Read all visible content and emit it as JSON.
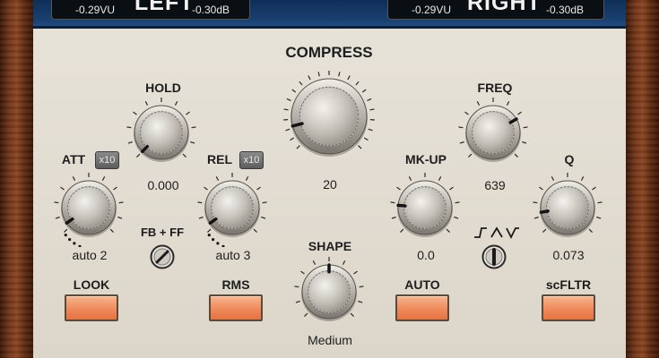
{
  "meters": {
    "left": {
      "vu": "-0.29VU",
      "db": "-0.30dB",
      "label": "LEFT"
    },
    "right": {
      "vu": "-0.29VU",
      "db": "-0.30dB",
      "label": "RIGHT"
    }
  },
  "knobs": {
    "compress": {
      "label": "COMPRESS",
      "value": "20"
    },
    "hold": {
      "label": "HOLD",
      "value": "0.000"
    },
    "att": {
      "label": "ATT",
      "value": "auto 2",
      "multiplier": "x10"
    },
    "rel": {
      "label": "REL",
      "value": "auto 3",
      "multiplier": "x10"
    },
    "mkup": {
      "label": "MK-UP",
      "value": "0.0"
    },
    "freq": {
      "label": "FREQ",
      "value": "639"
    },
    "q": {
      "label": "Q",
      "value": "0.073"
    },
    "shape": {
      "label": "SHAPE",
      "value": "Medium"
    }
  },
  "switches": {
    "fbff": {
      "label": "FB + FF"
    },
    "filter_shape": {
      "icon": "filter-shape-icons"
    }
  },
  "buttons": {
    "look": "LOOK",
    "rms": "RMS",
    "auto": "AUTO",
    "scfltr": "scFLTR"
  },
  "colors": {
    "panel": "#e0dbd0",
    "button_active": "#ef8a5b",
    "meter_bg": "#0a0f14",
    "top_bar": "#1a4070",
    "wood": "#6d3418"
  }
}
